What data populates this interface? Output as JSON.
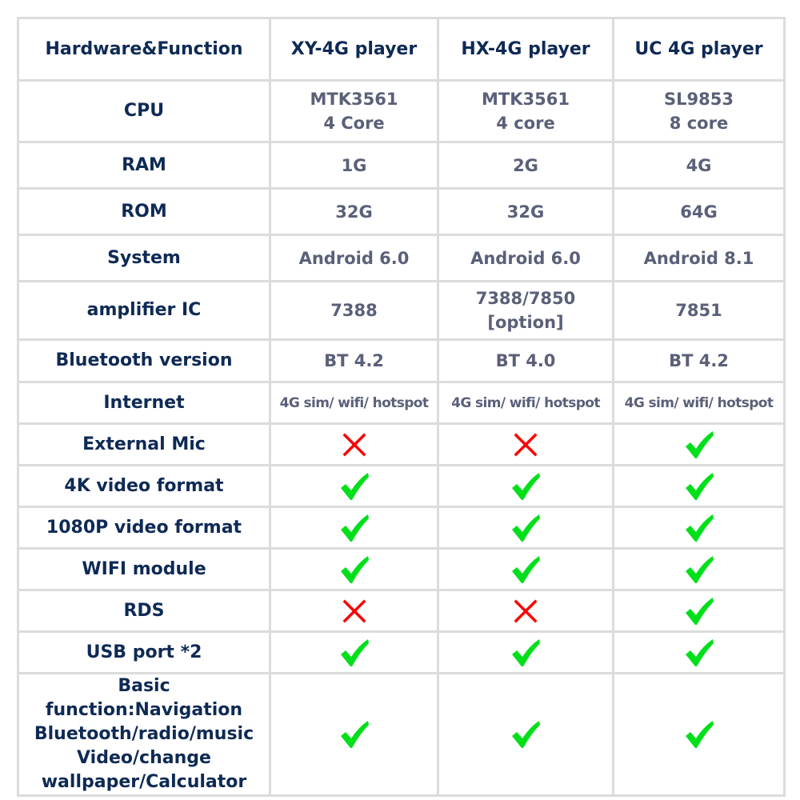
{
  "colors": {
    "check": "#00e01a",
    "cross": "#ff0000",
    "header_text": "#0e2a55",
    "value_text": "#5b6079",
    "border": "#dcdcdc"
  },
  "header": [
    "Hardware&Function",
    "XY-4G player",
    "HX-4G player",
    "UC 4G player"
  ],
  "rows": [
    {
      "label": [
        "CPU"
      ],
      "values": [
        [
          "MTK3561",
          "4 Core"
        ],
        [
          "MTK3561",
          "4 core"
        ],
        [
          "SL9853",
          "8 core"
        ]
      ]
    },
    {
      "label": [
        "RAM"
      ],
      "values": [
        [
          "1G"
        ],
        [
          "2G"
        ],
        [
          "4G"
        ]
      ]
    },
    {
      "label": [
        "ROM"
      ],
      "values": [
        [
          "32G"
        ],
        [
          "32G"
        ],
        [
          "64G"
        ]
      ]
    },
    {
      "label": [
        "System"
      ],
      "values": [
        [
          "Android 6.0"
        ],
        [
          "Android 6.0"
        ],
        [
          "Android 8.1"
        ]
      ]
    },
    {
      "label": [
        "amplifier IC"
      ],
      "values": [
        [
          "7388"
        ],
        [
          "7388/7850",
          "[option]"
        ],
        [
          "7851"
        ]
      ]
    },
    {
      "label": [
        "Bluetooth version"
      ],
      "values": [
        [
          "BT 4.2"
        ],
        [
          "BT 4.0"
        ],
        [
          "BT 4.2"
        ]
      ]
    },
    {
      "label": [
        "Internet"
      ],
      "small": true,
      "values": [
        [
          "4G sim/ wifi/ hotspot"
        ],
        [
          "4G sim/ wifi/ hotspot"
        ],
        [
          "4G sim/ wifi/ hotspot"
        ]
      ]
    },
    {
      "label": [
        "External Mic"
      ],
      "marks": [
        "cross-icon",
        "cross-icon",
        "check-icon"
      ]
    },
    {
      "label": [
        "4K video format"
      ],
      "marks": [
        "check-icon",
        "check-icon",
        "check-icon"
      ]
    },
    {
      "label": [
        "1080P video format"
      ],
      "marks": [
        "check-icon",
        "check-icon",
        "check-icon"
      ]
    },
    {
      "label": [
        "WIFI module"
      ],
      "marks": [
        "check-icon",
        "check-icon",
        "check-icon"
      ]
    },
    {
      "label": [
        "RDS"
      ],
      "marks": [
        "cross-icon",
        "cross-icon",
        "check-icon"
      ]
    },
    {
      "label": [
        "USB port *2"
      ],
      "marks": [
        "check-icon",
        "check-icon",
        "check-icon"
      ]
    },
    {
      "label": [
        "Basic function:Navigation",
        "Bluetooth/radio/music",
        "Video/change",
        "wallpaper/Calculator"
      ],
      "marks": [
        "check-icon",
        "check-icon",
        "check-icon"
      ]
    }
  ]
}
